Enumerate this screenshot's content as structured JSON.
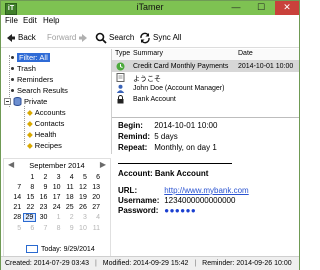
{
  "window": {
    "title": "iTamer",
    "icon_letter": "iT",
    "minimize": "—",
    "maximize": "☐",
    "close": "✕"
  },
  "menu": [
    "File",
    "Edit",
    "Help"
  ],
  "toolbar": {
    "back": "Back",
    "forward": "Forward",
    "search": "Search",
    "sync": "Sync All"
  },
  "tree": {
    "items": [
      "Filter: All",
      "Trash",
      "Reminders",
      "Search Results",
      "Private"
    ],
    "private_children": [
      "Accounts",
      "Contacts",
      "Health",
      "Recipes"
    ]
  },
  "calendar": {
    "month": "September 2014",
    "weeks": [
      [
        "",
        "1",
        "2",
        "3",
        "4",
        "5",
        "6"
      ],
      [
        "7",
        "8",
        "9",
        "10",
        "11",
        "12",
        "13"
      ],
      [
        "14",
        "15",
        "16",
        "17",
        "18",
        "19",
        "20"
      ],
      [
        "21",
        "22",
        "23",
        "24",
        "25",
        "26",
        "27"
      ],
      [
        "28",
        "29",
        "30",
        "1",
        "2",
        "3",
        "4"
      ],
      [
        "5",
        "6",
        "7",
        "8",
        "9",
        "10",
        "11"
      ]
    ],
    "today_label": "Today: 9/29/2014"
  },
  "list": {
    "headers": [
      "Type",
      "Summary",
      "Date"
    ],
    "rows": [
      {
        "type": "reminder",
        "summary": "Credit Card Monthly Payments",
        "date": "2014-10-01 10:00"
      },
      {
        "type": "note",
        "summary": "ようこそ",
        "date": ""
      },
      {
        "type": "contact",
        "summary": "John Doe (Account Manager)",
        "date": ""
      },
      {
        "type": "account",
        "summary": "Bank Account",
        "date": ""
      }
    ]
  },
  "detail": {
    "begin_label": "Begin:",
    "begin_value": "2014-10-01 10:00",
    "remind_label": "Remind:",
    "remind_value": "5 days",
    "repeat_label": "Repeat:",
    "repeat_value": "Monthly, on day 1",
    "account_title": "Account: Bank Account",
    "url_label": "URL:",
    "url_value": "http://www.mybank.com",
    "username_label": "Username:",
    "username_value": "1234000000000000",
    "password_label": "Password:",
    "password_value": "●●●●●●"
  },
  "status": {
    "created": "Created: 2014-07-29 03:43",
    "modified": "Modified: 2014-09-29 15:42",
    "reminder": "Reminder: 2014-09-26 10:00"
  }
}
